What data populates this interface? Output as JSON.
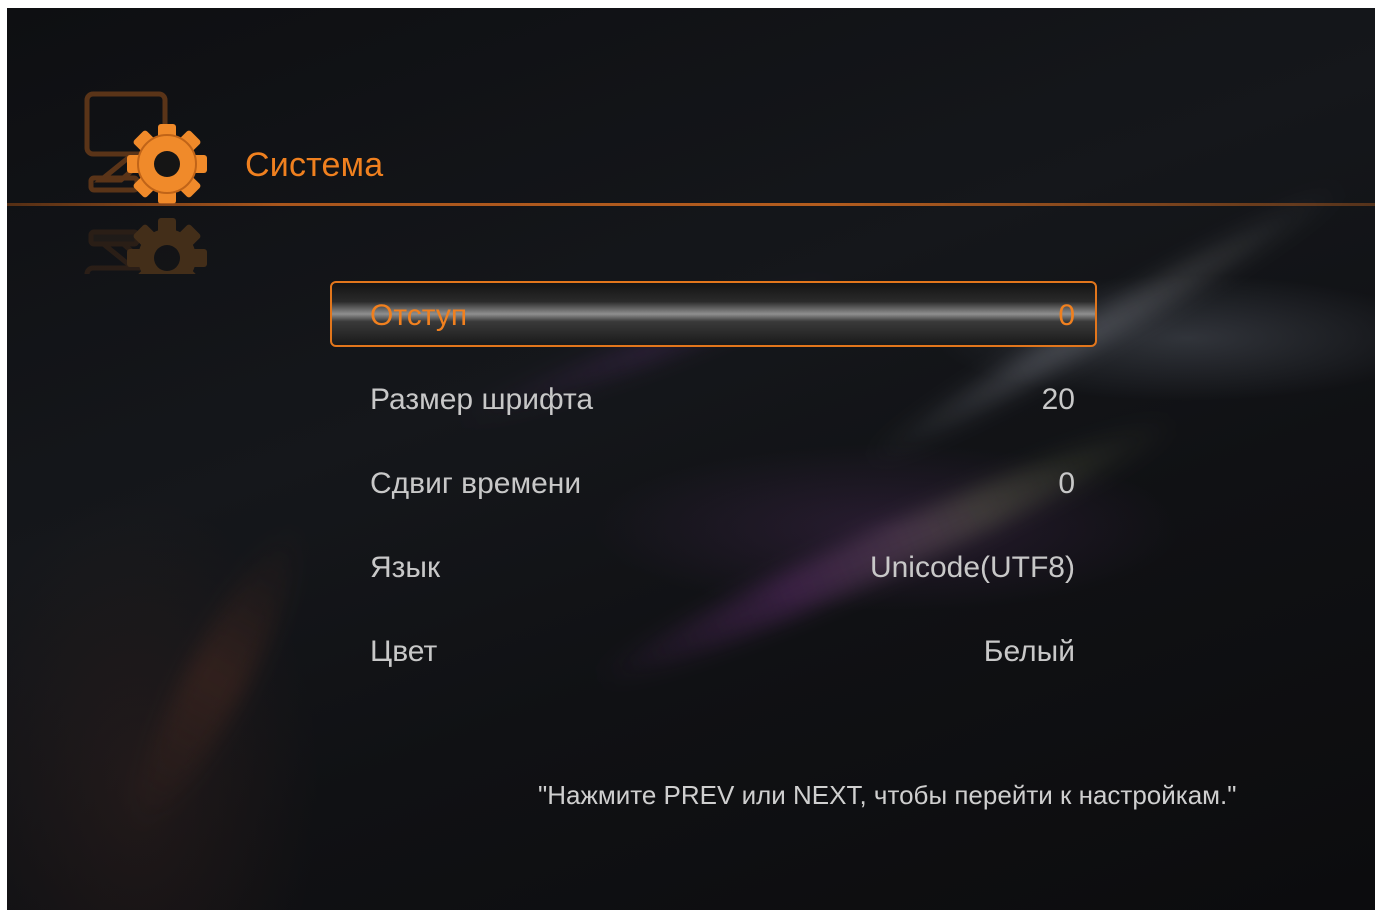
{
  "header": {
    "title": "Система",
    "icon": "system-settings-icon"
  },
  "settings": {
    "selected_index": 0,
    "items": [
      {
        "label": "Отступ",
        "value": "0"
      },
      {
        "label": "Размер шрифта",
        "value": "20"
      },
      {
        "label": "Сдвиг времени",
        "value": "0"
      },
      {
        "label": "Язык",
        "value": "Unicode(UTF8)"
      },
      {
        "label": "Цвет",
        "value": "Белый"
      }
    ]
  },
  "hint": "\"Нажмите PREV или NEXT, чтобы перейти к настройкам.\"",
  "colors": {
    "accent": "#f0801f",
    "text": "#c8c8c8",
    "background": "#111214"
  }
}
